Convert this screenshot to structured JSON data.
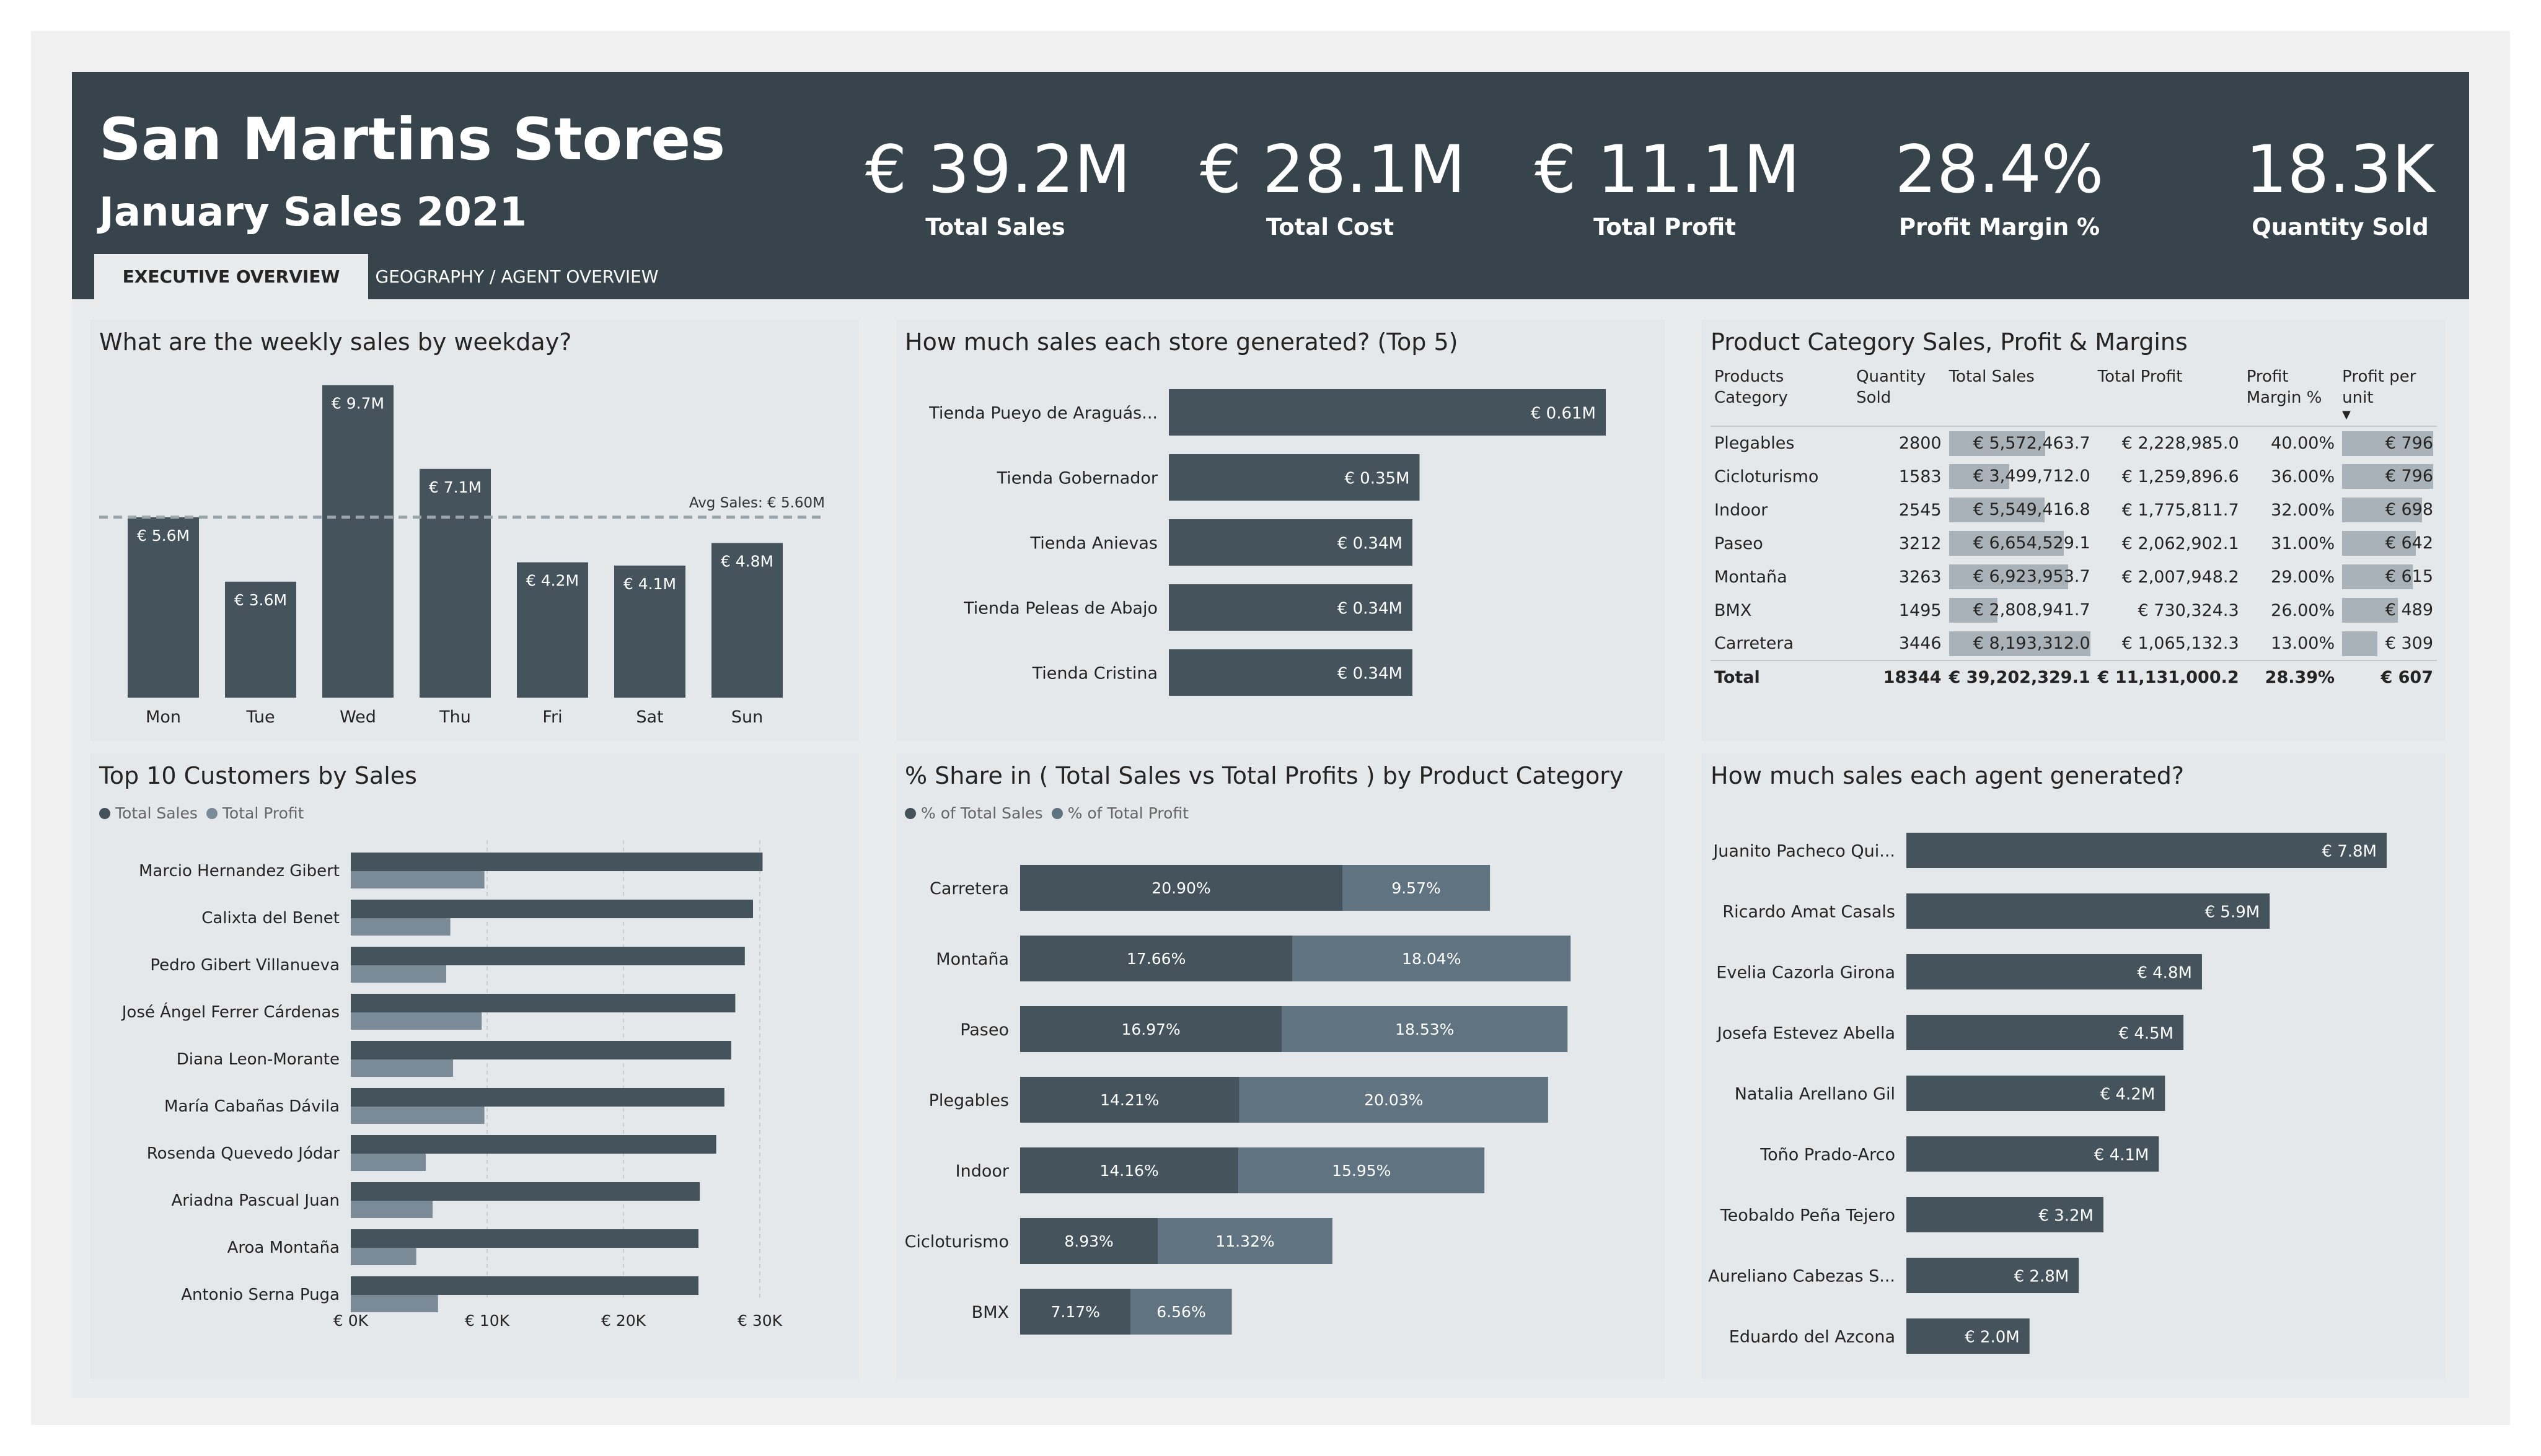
{
  "header": {
    "title": "San Martins Stores",
    "subtitle": "January Sales 2021",
    "tabs": [
      {
        "label": "EXECUTIVE OVERVIEW",
        "active": true
      },
      {
        "label": "GEOGRAPHY / AGENT OVERVIEW",
        "active": false
      }
    ]
  },
  "kpis": [
    {
      "value": "€ 39.2M",
      "label": "Total Sales"
    },
    {
      "value": "€ 28.1M",
      "label": "Total Cost"
    },
    {
      "value": "€ 11.1M",
      "label": "Total Profit"
    },
    {
      "value": "28.4%",
      "label": "Profit Margin %"
    },
    {
      "value": "18.3K",
      "label": "Quantity Sold"
    }
  ],
  "colors": {
    "header_bg": "#37444c",
    "bar_dark": "#45535d",
    "bar_light": "#7a8b97",
    "databar": "#a9b2b9"
  },
  "weekday": {
    "title": "What are the weekly sales by weekday?",
    "avg_label": "Avg Sales: € 5.60M"
  },
  "stores": {
    "title": "How much sales each store generated? (Top 5)"
  },
  "category_table": {
    "title": "Product Category Sales, Profit & Margins",
    "headers": [
      "Products Category",
      "Quantity Sold",
      "Total Sales",
      "Total Profit",
      "Profit Margin %",
      "Profit per unit"
    ],
    "sort_icon": "sort-down-icon",
    "rows": [
      {
        "category": "Plegables",
        "qty": "2800",
        "sales": "€ 5,572,463.7",
        "sales_frac": 0.68,
        "profit": "€ 2,228,985.0",
        "margin": "40.00%",
        "ppu": "€ 796",
        "ppu_frac": 1.0
      },
      {
        "category": "Cicloturismo",
        "qty": "1583",
        "sales": "€ 3,499,712.0",
        "sales_frac": 0.427,
        "profit": "€ 1,259,896.6",
        "margin": "36.00%",
        "ppu": "€ 796",
        "ppu_frac": 1.0
      },
      {
        "category": "Indoor",
        "qty": "2545",
        "sales": "€ 5,549,416.8",
        "sales_frac": 0.677,
        "profit": "€ 1,775,811.7",
        "margin": "32.00%",
        "ppu": "€ 698",
        "ppu_frac": 0.877
      },
      {
        "category": "Paseo",
        "qty": "3212",
        "sales": "€ 6,654,529.1",
        "sales_frac": 0.812,
        "profit": "€ 2,062,902.1",
        "margin": "31.00%",
        "ppu": "€ 642",
        "ppu_frac": 0.807
      },
      {
        "category": "Montaña",
        "qty": "3263",
        "sales": "€ 6,923,953.7",
        "sales_frac": 0.845,
        "profit": "€ 2,007,948.2",
        "margin": "29.00%",
        "ppu": "€ 615",
        "ppu_frac": 0.773
      },
      {
        "category": "BMX",
        "qty": "1495",
        "sales": "€ 2,808,941.7",
        "sales_frac": 0.343,
        "profit": "€ 730,324.3",
        "margin": "26.00%",
        "ppu": "€ 489",
        "ppu_frac": 0.614
      },
      {
        "category": "Carretera",
        "qty": "3446",
        "sales": "€ 8,193,312.0",
        "sales_frac": 1.0,
        "profit": "€ 1,065,132.3",
        "margin": "13.00%",
        "ppu": "€ 309",
        "ppu_frac": 0.388
      }
    ],
    "total": {
      "label": "Total",
      "qty": "18344",
      "sales": "€ 39,202,329.1",
      "profit": "€ 11,131,000.2",
      "margin": "28.39%",
      "ppu": "€ 607"
    }
  },
  "customers": {
    "title": "Top 10 Customers by Sales",
    "legend": [
      "Total Sales",
      "Total Profit"
    ]
  },
  "share": {
    "title": "% Share in ( Total Sales vs Total Profits ) by Product Category",
    "legend": [
      "% of Total Sales",
      "% of Total Profit"
    ]
  },
  "agents": {
    "title": "How much sales each agent generated?"
  },
  "chart_data": [
    {
      "type": "bar",
      "title": "What are the weekly sales by weekday?",
      "categories": [
        "Mon",
        "Tue",
        "Wed",
        "Thu",
        "Fri",
        "Sat",
        "Sun"
      ],
      "values": [
        5.6,
        3.6,
        9.7,
        7.1,
        4.2,
        4.1,
        4.8
      ],
      "labels": [
        "€ 5.6M",
        "€ 3.6M",
        "€ 9.7M",
        "€ 7.1M",
        "€ 4.2M",
        "€ 4.1M",
        "€ 4.8M"
      ],
      "reference_line": 5.6,
      "unit": "€ M",
      "ylim": [
        0,
        10
      ]
    },
    {
      "type": "bar",
      "orientation": "horizontal",
      "title": "How much sales each store generated? (Top 5)",
      "categories": [
        "Tienda Pueyo de Araguás...",
        "Tienda Gobernador",
        "Tienda Anievas",
        "Tienda Peleas de Abajo",
        "Tienda Cristina"
      ],
      "values": [
        0.61,
        0.35,
        0.34,
        0.34,
        0.34
      ],
      "labels": [
        "€ 0.61M",
        "€ 0.35M",
        "€ 0.34M",
        "€ 0.34M",
        "€ 0.34M"
      ]
    },
    {
      "type": "bar",
      "orientation": "horizontal",
      "title": "Top 10 Customers by Sales",
      "categories": [
        "Marcio Hernandez Gibert",
        "Calixta del Benet",
        "Pedro Gibert Villanueva",
        "José Ángel Ferrer Cárdenas",
        "Diana Leon-Morante",
        "María Cabañas Dávila",
        "Rosenda Quevedo Jódar",
        "Ariadna Pascual Juan",
        "Aroa Montaña",
        "Antonio Serna Puga"
      ],
      "series": [
        {
          "name": "Total Sales",
          "values": [
            30200,
            29500,
            28900,
            28200,
            27900,
            27400,
            26800,
            25600,
            25500,
            25500
          ]
        },
        {
          "name": "Total Profit",
          "values": [
            9800,
            7300,
            7000,
            9600,
            7500,
            9800,
            5500,
            6000,
            4800,
            6400
          ]
        }
      ],
      "xticks": [
        "€ 0K",
        "€ 10K",
        "€ 20K",
        "€ 30K"
      ],
      "xlim": [
        0,
        30000
      ]
    },
    {
      "type": "bar",
      "orientation": "horizontal",
      "stacked": true,
      "title": "% Share in ( Total Sales vs Total Profits ) by Product Category",
      "categories": [
        "Carretera",
        "Montaña",
        "Paseo",
        "Plegables",
        "Indoor",
        "Cicloturismo",
        "BMX"
      ],
      "series": [
        {
          "name": "% of Total Sales",
          "values": [
            20.9,
            17.66,
            16.97,
            14.21,
            14.16,
            8.93,
            7.17
          ],
          "labels": [
            "20.90%",
            "17.66%",
            "16.97%",
            "14.21%",
            "14.16%",
            "8.93%",
            "7.17%"
          ]
        },
        {
          "name": "% of Total Profit",
          "values": [
            9.57,
            18.04,
            18.53,
            20.03,
            15.95,
            11.32,
            6.56
          ],
          "labels": [
            "9.57%",
            "18.04%",
            "18.53%",
            "20.03%",
            "15.95%",
            "11.32%",
            "6.56%"
          ]
        }
      ]
    },
    {
      "type": "bar",
      "orientation": "horizontal",
      "title": "How much sales each agent generated?",
      "categories": [
        "Juanito Pacheco Qui...",
        "Ricardo Amat Casals",
        "Evelia Cazorla Girona",
        "Josefa Estevez Abella",
        "Natalia Arellano Gil",
        "Toño Prado-Arco",
        "Teobaldo Peña Tejero",
        "Aureliano Cabezas S...",
        "Eduardo del Azcona"
      ],
      "values": [
        7.8,
        5.9,
        4.8,
        4.5,
        4.2,
        4.1,
        3.2,
        2.8,
        2.0
      ],
      "labels": [
        "€ 7.8M",
        "€ 5.9M",
        "€ 4.8M",
        "€ 4.5M",
        "€ 4.2M",
        "€ 4.1M",
        "€ 3.2M",
        "€ 2.8M",
        "€ 2.0M"
      ]
    }
  ]
}
